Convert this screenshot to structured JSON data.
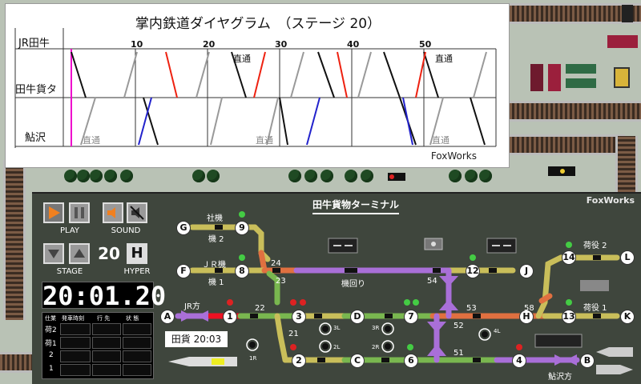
{
  "diagram": {
    "title": "掌内鉄道ダイヤグラム　（ステージ 20）",
    "stations": [
      "JR田牛",
      "田牛貨タ",
      "鮎沢"
    ],
    "ticks": [
      "10",
      "20",
      "30",
      "40",
      "50"
    ],
    "through_labels": [
      "直通",
      "直通",
      "直通",
      "直通",
      "直通"
    ],
    "credit": "FoxWorks"
  },
  "panel": {
    "brand": "FoxWorks",
    "title": "田牛貨物ターミナル",
    "play_label": "PLAY",
    "sound_label": "SOUND",
    "stage_label": "STAGE",
    "hyper_label": "HYPER",
    "stage_number": "20",
    "hyper_key": "H",
    "clock": "20:01.20",
    "table_headers": [
      "仕業",
      "発車時刻",
      "行 先",
      "状 態"
    ],
    "table_rows": [
      "荷2",
      "荷1",
      "2",
      "1"
    ],
    "train_info": "田貨 20:03"
  },
  "layout": {
    "letters": [
      "G",
      "F",
      "A",
      "D",
      "C",
      "J",
      "H",
      "K",
      "L",
      "B"
    ],
    "node_numbers": [
      "9",
      "8",
      "1",
      "3",
      "2",
      "7",
      "6",
      "12",
      "4",
      "13",
      "14"
    ],
    "switch_numbers": [
      "24",
      "23",
      "22",
      "21",
      "54",
      "53",
      "58",
      "52",
      "51"
    ],
    "labels": {
      "shaki": "社機",
      "ki2": "機 2",
      "jrki": "ＪＲ機",
      "ki1": "機 1",
      "kimawari": "機回り",
      "jrho": "JR方",
      "ayuho": "鮎沢方",
      "niyaku2": "荷役 2",
      "niyaku1": "荷役 1",
      "s3l": "3L",
      "s2l": "2L",
      "s3r": "3R",
      "s2r": "2R",
      "s4l": "4L",
      "s1r": "1R"
    }
  }
}
